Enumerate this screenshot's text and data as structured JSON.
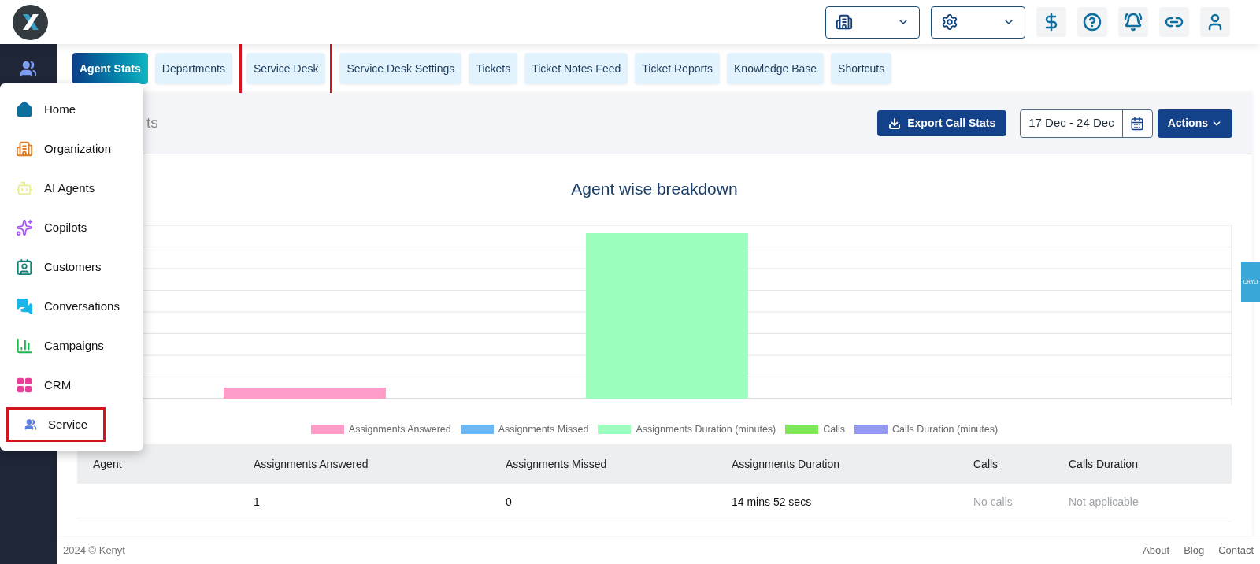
{
  "header": {
    "selectors": [
      {
        "kind": "building"
      },
      {
        "kind": "ai"
      }
    ],
    "icon_buttons": [
      {
        "kind": "dollar"
      },
      {
        "kind": "help"
      },
      {
        "kind": "bell"
      },
      {
        "kind": "link"
      },
      {
        "kind": "user"
      }
    ]
  },
  "tabs": [
    {
      "label": "Agent Stats",
      "selected": true,
      "highlighted": false
    },
    {
      "label": "Departments",
      "selected": false,
      "highlighted": false
    },
    {
      "label": "Service Desk",
      "selected": false,
      "highlighted": true
    },
    {
      "label": "Service Desk Settings",
      "selected": false,
      "highlighted": false
    },
    {
      "label": "Tickets",
      "selected": false,
      "highlighted": false
    },
    {
      "label": "Ticket Notes Feed",
      "selected": false,
      "highlighted": false
    },
    {
      "label": "Ticket Reports",
      "selected": false,
      "highlighted": false
    },
    {
      "label": "Knowledge Base",
      "selected": false,
      "highlighted": false
    },
    {
      "label": "Shortcuts",
      "selected": false,
      "highlighted": false
    }
  ],
  "panel": {
    "title_visible_part": "ts",
    "export_button": "Export Call Stats",
    "date_range": "17 Dec - 24 Dec",
    "actions_button": "Actions"
  },
  "chart": {
    "title": "Agent wise breakdown",
    "legend": [
      {
        "label": "Assignments Answered",
        "color": "#ff9cc8"
      },
      {
        "label": "Assignments Missed",
        "color": "#6bb8f5"
      },
      {
        "label": "Assignments Duration (minutes)",
        "color": "#9dffbe"
      },
      {
        "label": "Calls",
        "color": "#7fe85a"
      },
      {
        "label": "Calls Duration (minutes)",
        "color": "#9399f0"
      }
    ]
  },
  "table": {
    "columns": [
      "Agent",
      "Assignments Answered",
      "Assignments Missed",
      "Assignments Duration",
      "Calls",
      "Calls Duration"
    ],
    "rows": [
      {
        "cells": [
          {
            "text": ""
          },
          {
            "text": "1",
            "muted": false
          },
          {
            "text": "0",
            "muted": false
          },
          {
            "text": "14 mins 52 secs",
            "muted": false
          },
          {
            "text": "No calls",
            "muted": true
          },
          {
            "text": "Not applicable",
            "muted": true
          }
        ]
      }
    ]
  },
  "side_tab": {
    "label": "CRYO"
  },
  "footer": {
    "copyright": "2024 © Kenyt",
    "links": [
      "About",
      "Blog",
      "Contact"
    ]
  },
  "menu": {
    "items": [
      {
        "label": "Home",
        "kind": "home",
        "highlighted": false
      },
      {
        "label": "Organization",
        "kind": "organization",
        "highlighted": false
      },
      {
        "label": "AI Agents",
        "kind": "agents",
        "highlighted": false
      },
      {
        "label": "Copilots",
        "kind": "copilots",
        "highlighted": false
      },
      {
        "label": "Customers",
        "kind": "customers",
        "highlighted": false
      },
      {
        "label": "Conversations",
        "kind": "conversations",
        "highlighted": false
      },
      {
        "label": "Campaigns",
        "kind": "campaigns",
        "highlighted": false
      },
      {
        "label": "CRM",
        "kind": "crm",
        "highlighted": false
      },
      {
        "label": "Service",
        "kind": "service",
        "highlighted": true
      }
    ]
  }
}
